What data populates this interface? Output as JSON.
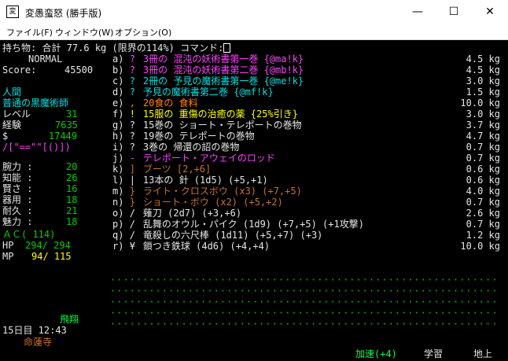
{
  "window": {
    "title": "変愚蛮怒 (勝手版)",
    "icon_text": "変",
    "minimize": "—",
    "maximize": "☐",
    "close": "✕"
  },
  "menu": [
    "ファイル(F)",
    "ウィンドウ(W)",
    "オプション(O)"
  ],
  "header": {
    "prefix": "持ち物: 合計",
    "weight": "77.6",
    "suffix": "kg (限界の114%) コマンド:"
  },
  "status": {
    "mode": "NORMAL",
    "score_label": "Score:",
    "score": "45500",
    "race": "人間",
    "class": "普通の黒魔術師",
    "level_label": "レベル",
    "level": "31",
    "exp_label": "経験",
    "exp": "7635",
    "gold_label": "$",
    "gold": "17449",
    "equip_str": "/[\"==\"\"[()])",
    "stats": [
      {
        "label": "腕力 :",
        "value": "20"
      },
      {
        "label": "知能 :",
        "value": "26"
      },
      {
        "label": "賢さ :",
        "value": "16"
      },
      {
        "label": "器用 :",
        "value": "18"
      },
      {
        "label": "耐久 :",
        "value": "21"
      },
      {
        "label": "魅力 :",
        "value": "18"
      }
    ],
    "ac": "ＡＣ( 114)",
    "hp_label": "HP",
    "hp": "294/ 294",
    "mp_label": "MP",
    "mp": "94/ 115",
    "flying": "飛翔",
    "datetime": "15日目 12:43",
    "location": "命蓮寺"
  },
  "inventory": [
    {
      "key": "a)",
      "sym": "?",
      "name": "3冊の 混沌の妖術書第一巻 {@ma!k}",
      "weight": "4.5 kg",
      "color": "#ff40ff"
    },
    {
      "key": "b)",
      "sym": "?",
      "name": "3冊の 混沌の妖術書第二巻 {@mb!k}",
      "weight": "4.5 kg",
      "color": "#ff40ff"
    },
    {
      "key": "c)",
      "sym": "?",
      "name": "2冊の 予見の魔術書第一巻 {@me!k}",
      "weight": "3.0 kg",
      "color": "#00e0e0"
    },
    {
      "key": "d)",
      "sym": "?",
      "name": "予見の魔術書第二巻 {@mf!k}",
      "weight": "1.5 kg",
      "color": "#00e0e0"
    },
    {
      "key": "e)",
      "sym": ",",
      "name": "20食の 食料",
      "weight": "10.0 kg",
      "color": "#ff8000"
    },
    {
      "key": "f)",
      "sym": "!",
      "name": "15服の 重傷の治癒の薬 {25%引き}",
      "weight": "3.0 kg",
      "color": "#ffff00"
    },
    {
      "key": "g)",
      "sym": "?",
      "name": "15巻の ショート・テレポートの巻物",
      "weight": "3.7 kg",
      "color": "#e6e6e6"
    },
    {
      "key": "h)",
      "sym": "?",
      "name": "19巻の テレポートの巻物",
      "weight": "4.7 kg",
      "color": "#e6e6e6"
    },
    {
      "key": "i)",
      "sym": "?",
      "name": "3巻の 帰還の詔の巻物",
      "weight": "0.7 kg",
      "color": "#e6e6e6"
    },
    {
      "key": "j)",
      "sym": "-",
      "name": "テレポート・アウェイのロッド",
      "weight": "0.7 kg",
      "color": "#ff40ff"
    },
    {
      "key": "k)",
      "sym": "]",
      "name": "ブーツ [2,+6]",
      "weight": "0.6 kg",
      "color": "#c87030"
    },
    {
      "key": "l)",
      "sym": "|",
      "name": "13本の 針 (1d5) (+5,+1)",
      "weight": "0.6 kg",
      "color": "#e6e6e6"
    },
    {
      "key": "m)",
      "sym": "}",
      "name": "ライト・クロスボウ (x3) (+7,+5)",
      "weight": "4.0 kg",
      "color": "#c87030"
    },
    {
      "key": "n)",
      "sym": "}",
      "name": "ショート・ボウ (x2) (+5,+2)",
      "weight": "0.7 kg",
      "color": "#c87030"
    },
    {
      "key": "o)",
      "sym": "/",
      "name": "薙刀 (2d7) (+3,+6)",
      "weight": "2.6 kg",
      "color": "#e6e6e6"
    },
    {
      "key": "p)",
      "sym": "/",
      "name": "乱舞のオウル・パイク (1d9) (+7,+5) (+1攻撃)",
      "weight": "0.7 kg",
      "color": "#e6e6e6"
    },
    {
      "key": "q)",
      "sym": "/",
      "name": "竜殺しの六尺棒 (1d11) (+5,+7) (+3)",
      "weight": "1.2 kg",
      "color": "#e6e6e6"
    },
    {
      "key": "r)",
      "sym": "¥",
      "name": "鎖つき鉄球 (4d6) (+4,+4)",
      "weight": "10.0 kg",
      "color": "#e6e6e6"
    }
  ],
  "bottom": {
    "haste": "加速(+4)",
    "study": "学習",
    "place": "地上"
  }
}
